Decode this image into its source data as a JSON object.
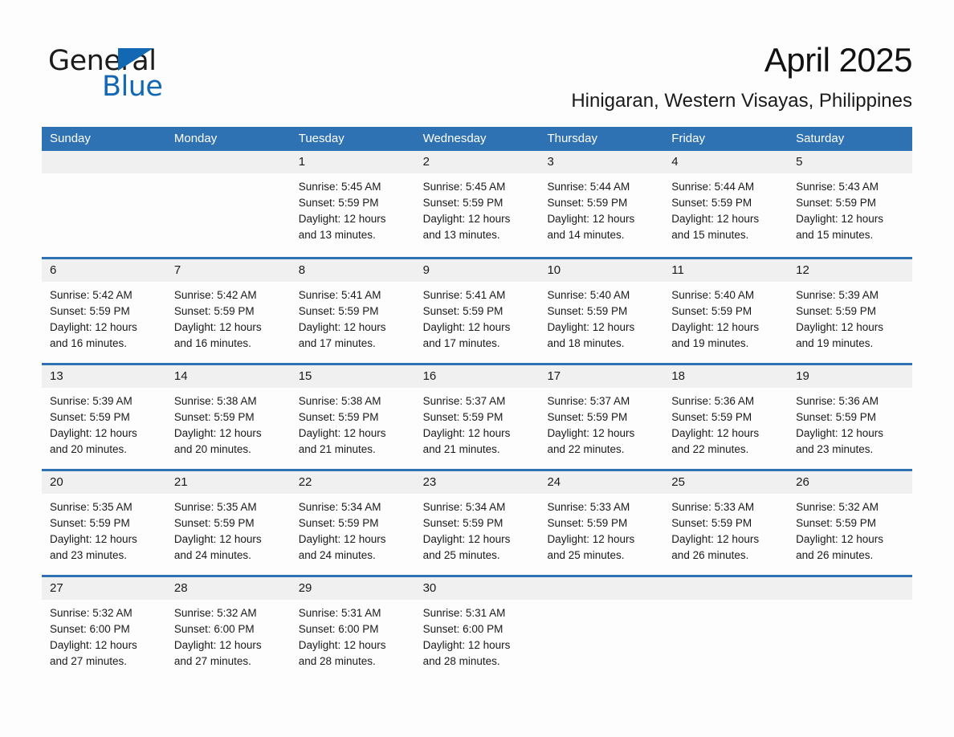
{
  "brand": {
    "word1": "General",
    "word2": "Blue",
    "triangle_color": "#1268b3"
  },
  "header": {
    "month_title": "April 2025",
    "location": "Hinigaran, Western Visayas, Philippines"
  },
  "colors": {
    "header_bar": "#2e72b4",
    "row_divider": "#2e72b4",
    "date_band": "#f0f0f0",
    "page_background": "#fdfdfd",
    "text": "#1a1a1a"
  },
  "calendar": {
    "day_headers": [
      "Sunday",
      "Monday",
      "Tuesday",
      "Wednesday",
      "Thursday",
      "Friday",
      "Saturday"
    ],
    "weeks": [
      [
        {
          "date": "",
          "lines": []
        },
        {
          "date": "",
          "lines": []
        },
        {
          "date": "1",
          "lines": [
            "Sunrise: 5:45 AM",
            "Sunset: 5:59 PM",
            "Daylight: 12 hours",
            "and 13 minutes."
          ]
        },
        {
          "date": "2",
          "lines": [
            "Sunrise: 5:45 AM",
            "Sunset: 5:59 PM",
            "Daylight: 12 hours",
            "and 13 minutes."
          ]
        },
        {
          "date": "3",
          "lines": [
            "Sunrise: 5:44 AM",
            "Sunset: 5:59 PM",
            "Daylight: 12 hours",
            "and 14 minutes."
          ]
        },
        {
          "date": "4",
          "lines": [
            "Sunrise: 5:44 AM",
            "Sunset: 5:59 PM",
            "Daylight: 12 hours",
            "and 15 minutes."
          ]
        },
        {
          "date": "5",
          "lines": [
            "Sunrise: 5:43 AM",
            "Sunset: 5:59 PM",
            "Daylight: 12 hours",
            "and 15 minutes."
          ]
        }
      ],
      [
        {
          "date": "6",
          "lines": [
            "Sunrise: 5:42 AM",
            "Sunset: 5:59 PM",
            "Daylight: 12 hours",
            "and 16 minutes."
          ]
        },
        {
          "date": "7",
          "lines": [
            "Sunrise: 5:42 AM",
            "Sunset: 5:59 PM",
            "Daylight: 12 hours",
            "and 16 minutes."
          ]
        },
        {
          "date": "8",
          "lines": [
            "Sunrise: 5:41 AM",
            "Sunset: 5:59 PM",
            "Daylight: 12 hours",
            "and 17 minutes."
          ]
        },
        {
          "date": "9",
          "lines": [
            "Sunrise: 5:41 AM",
            "Sunset: 5:59 PM",
            "Daylight: 12 hours",
            "and 17 minutes."
          ]
        },
        {
          "date": "10",
          "lines": [
            "Sunrise: 5:40 AM",
            "Sunset: 5:59 PM",
            "Daylight: 12 hours",
            "and 18 minutes."
          ]
        },
        {
          "date": "11",
          "lines": [
            "Sunrise: 5:40 AM",
            "Sunset: 5:59 PM",
            "Daylight: 12 hours",
            "and 19 minutes."
          ]
        },
        {
          "date": "12",
          "lines": [
            "Sunrise: 5:39 AM",
            "Sunset: 5:59 PM",
            "Daylight: 12 hours",
            "and 19 minutes."
          ]
        }
      ],
      [
        {
          "date": "13",
          "lines": [
            "Sunrise: 5:39 AM",
            "Sunset: 5:59 PM",
            "Daylight: 12 hours",
            "and 20 minutes."
          ]
        },
        {
          "date": "14",
          "lines": [
            "Sunrise: 5:38 AM",
            "Sunset: 5:59 PM",
            "Daylight: 12 hours",
            "and 20 minutes."
          ]
        },
        {
          "date": "15",
          "lines": [
            "Sunrise: 5:38 AM",
            "Sunset: 5:59 PM",
            "Daylight: 12 hours",
            "and 21 minutes."
          ]
        },
        {
          "date": "16",
          "lines": [
            "Sunrise: 5:37 AM",
            "Sunset: 5:59 PM",
            "Daylight: 12 hours",
            "and 21 minutes."
          ]
        },
        {
          "date": "17",
          "lines": [
            "Sunrise: 5:37 AM",
            "Sunset: 5:59 PM",
            "Daylight: 12 hours",
            "and 22 minutes."
          ]
        },
        {
          "date": "18",
          "lines": [
            "Sunrise: 5:36 AM",
            "Sunset: 5:59 PM",
            "Daylight: 12 hours",
            "and 22 minutes."
          ]
        },
        {
          "date": "19",
          "lines": [
            "Sunrise: 5:36 AM",
            "Sunset: 5:59 PM",
            "Daylight: 12 hours",
            "and 23 minutes."
          ]
        }
      ],
      [
        {
          "date": "20",
          "lines": [
            "Sunrise: 5:35 AM",
            "Sunset: 5:59 PM",
            "Daylight: 12 hours",
            "and 23 minutes."
          ]
        },
        {
          "date": "21",
          "lines": [
            "Sunrise: 5:35 AM",
            "Sunset: 5:59 PM",
            "Daylight: 12 hours",
            "and 24 minutes."
          ]
        },
        {
          "date": "22",
          "lines": [
            "Sunrise: 5:34 AM",
            "Sunset: 5:59 PM",
            "Daylight: 12 hours",
            "and 24 minutes."
          ]
        },
        {
          "date": "23",
          "lines": [
            "Sunrise: 5:34 AM",
            "Sunset: 5:59 PM",
            "Daylight: 12 hours",
            "and 25 minutes."
          ]
        },
        {
          "date": "24",
          "lines": [
            "Sunrise: 5:33 AM",
            "Sunset: 5:59 PM",
            "Daylight: 12 hours",
            "and 25 minutes."
          ]
        },
        {
          "date": "25",
          "lines": [
            "Sunrise: 5:33 AM",
            "Sunset: 5:59 PM",
            "Daylight: 12 hours",
            "and 26 minutes."
          ]
        },
        {
          "date": "26",
          "lines": [
            "Sunrise: 5:32 AM",
            "Sunset: 5:59 PM",
            "Daylight: 12 hours",
            "and 26 minutes."
          ]
        }
      ],
      [
        {
          "date": "27",
          "lines": [
            "Sunrise: 5:32 AM",
            "Sunset: 6:00 PM",
            "Daylight: 12 hours",
            "and 27 minutes."
          ]
        },
        {
          "date": "28",
          "lines": [
            "Sunrise: 5:32 AM",
            "Sunset: 6:00 PM",
            "Daylight: 12 hours",
            "and 27 minutes."
          ]
        },
        {
          "date": "29",
          "lines": [
            "Sunrise: 5:31 AM",
            "Sunset: 6:00 PM",
            "Daylight: 12 hours",
            "and 28 minutes."
          ]
        },
        {
          "date": "30",
          "lines": [
            "Sunrise: 5:31 AM",
            "Sunset: 6:00 PM",
            "Daylight: 12 hours",
            "and 28 minutes."
          ]
        },
        {
          "date": "",
          "lines": []
        },
        {
          "date": "",
          "lines": []
        },
        {
          "date": "",
          "lines": []
        }
      ]
    ]
  }
}
